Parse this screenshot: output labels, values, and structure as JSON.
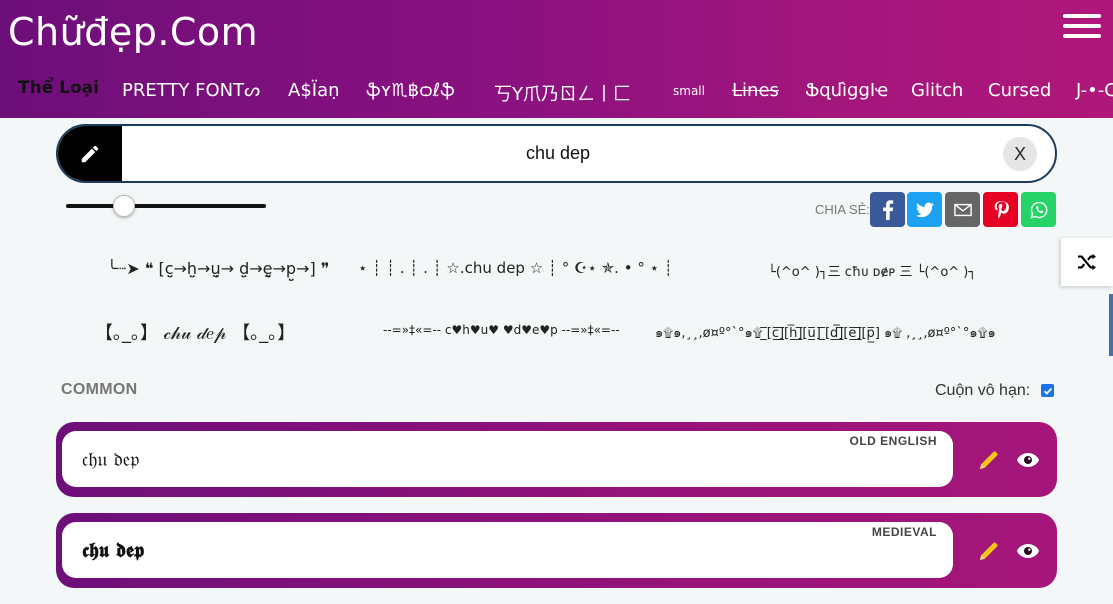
{
  "header": {
    "logo": "Chữđẹp.Com",
    "menu_icon": "hamburger-menu-icon"
  },
  "categories": [
    {
      "label": "Thể Loại"
    },
    {
      "label": "PRETTY FONTᔕ"
    },
    {
      "label": "A$Ïaṇ"
    },
    {
      "label": "ֆʏ♏฿ѻℓֆ"
    },
    {
      "label": "丂Y爪乃ㄖㄥ丨匚"
    },
    {
      "label": "small"
    },
    {
      "label": "Lines"
    },
    {
      "label": "ՖզմìցցӀҽ"
    },
    {
      "label": "Glitch"
    },
    {
      "label": "Cursed"
    },
    {
      "label": "J-•-C"
    }
  ],
  "search": {
    "value": "chu dep",
    "clear_label": "X"
  },
  "slider": {
    "value_fraction": 0.29
  },
  "share": {
    "label": "CHIA SẺ:",
    "buttons": [
      {
        "name": "facebook",
        "color": "#3b5998"
      },
      {
        "name": "twitter",
        "color": "#1da1f2"
      },
      {
        "name": "email",
        "color": "#666666"
      },
      {
        "name": "pinterest",
        "color": "#e60023"
      },
      {
        "name": "whatsapp",
        "color": "#25d366"
      }
    ]
  },
  "decorations": {
    "row1": [
      "╰┈➤ ❝ [c̤̮→h̤̮→ṳ̮→ d̤̮→ḛ̮→p̤̮→] ❞",
      "⋆ ┊ ┊ . ┊ . ┊ ☆.chu dep ☆ ┊ ° ☪⋆ ✯. • ° ⋆ ┊",
      "└(^o^ )┐三 ᴄħᴜ ᴅɇᴘ 三 └(^o^ )┐"
    ],
    "row2": [
      "【｡_｡】 𝒸𝒽𝓊 𝒹𝑒𝓅 【｡_｡】",
      "--=»‡«=-- c♥h♥u♥ ♥d♥e♥p --=»‡«=--",
      "๑۩๑,¸¸,ø¤º°`°๑۩ [̲̅c̲̅][̲̅h̲̅][̲̅u̲̅] [̲̅d̲̅][̲̅e̲̅][̲̅p̲̅] ๑۩ ,¸¸,ø¤º°`°๑۩๑"
    ]
  },
  "common": {
    "title": "COMMON",
    "infinite_scroll_label": "Cuộn vô hạn:",
    "infinite_scroll_checked": true,
    "cards": [
      {
        "label": "OLD ENGLISH",
        "text": "𝔠𝔥𝔲 𝔡𝔢𝔭"
      },
      {
        "label": "MEDIEVAL",
        "text": "𝖈𝖍𝖚 𝖉𝖊𝖕"
      }
    ]
  },
  "colors": {
    "header_gradient_start": "#6d0f79",
    "header_gradient_end": "#b0177a",
    "accent_pencil": "#f5c518"
  }
}
